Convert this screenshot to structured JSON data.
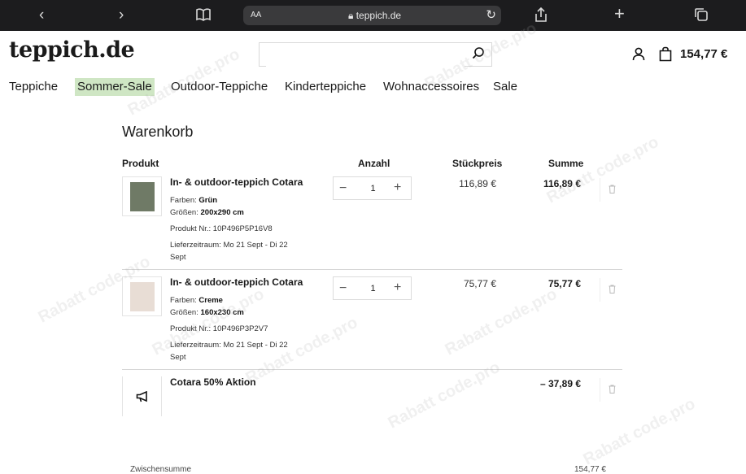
{
  "browser": {
    "aa": "AA",
    "url": "teppich.de"
  },
  "header": {
    "logo": "teppich.de",
    "search_placeholder": "",
    "cart_total": "154,77 €"
  },
  "nav": [
    "Teppiche",
    "Sommer-Sale",
    "Outdoor-Teppiche",
    "Kinderteppiche",
    "Wohnaccessoires",
    "Sale"
  ],
  "cart": {
    "title": "Warenkorb",
    "columns": {
      "product": "Produkt",
      "qty": "Anzahl",
      "unit_price": "Stückpreis",
      "total": "Summe"
    },
    "items": [
      {
        "name": "In- & outdoor-teppich Cotara",
        "color_label": "Farben:",
        "color": "Grün",
        "size_label": "Größen:",
        "size": "200x290 cm",
        "sku": "Produkt Nr.: 10P496P5P16V8",
        "delivery_1": "Lieferzeitraum: Mo 21 Sept - Di 22",
        "delivery_2": "Sept",
        "qty": "1",
        "unit_price": "116,89 €",
        "total": "116,89 €",
        "swatch_color": "#6f7a66"
      },
      {
        "name": "In- & outdoor-teppich Cotara",
        "color_label": "Farben:",
        "color": "Creme",
        "size_label": "Größen:",
        "size": "160x230 cm",
        "sku": "Produkt Nr.: 10P496P3P2V7",
        "delivery_1": "Lieferzeitraum: Mo 21 Sept - Di 22",
        "delivery_2": "Sept",
        "qty": "1",
        "unit_price": "75,77 €",
        "total": "75,77 €",
        "swatch_color": "#e8ddd5"
      }
    ],
    "promo": {
      "name": "Cotara 50% Aktion",
      "total": "– 37,89 €"
    }
  },
  "footer": {
    "subtotal_label": "Zwischensumme",
    "subtotal": "154,77 €"
  },
  "watermark": "Rabatt code.pro"
}
